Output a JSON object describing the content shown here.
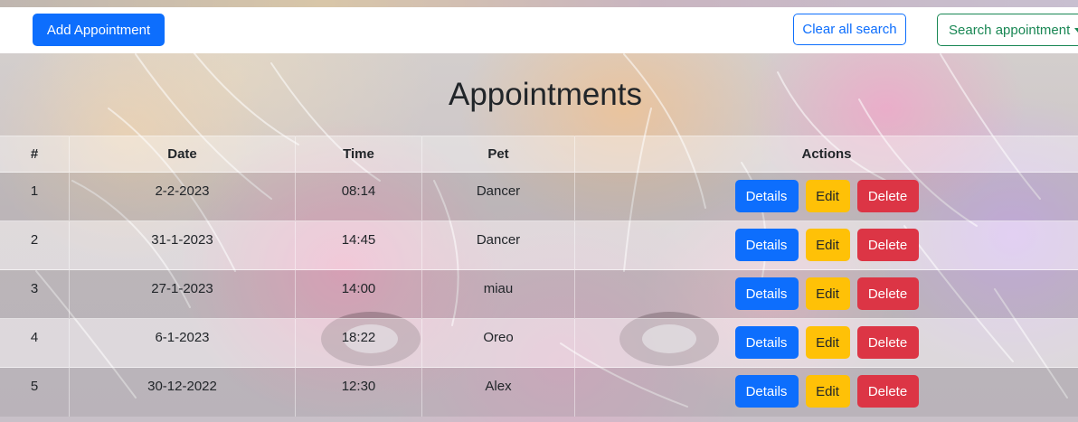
{
  "toolbar": {
    "add_label": "Add Appointment",
    "clear_label": "Clear all search",
    "search_label": "Search appointment"
  },
  "page": {
    "title": "Appointments"
  },
  "table": {
    "headers": [
      "#",
      "Date",
      "Time",
      "Pet",
      "Actions"
    ],
    "rows": [
      {
        "num": "1",
        "date": "2-2-2023",
        "time": "08:14",
        "pet": "Dancer"
      },
      {
        "num": "2",
        "date": "31-1-2023",
        "time": "14:45",
        "pet": "Dancer"
      },
      {
        "num": "3",
        "date": "27-1-2023",
        "time": "14:00",
        "pet": "miau"
      },
      {
        "num": "4",
        "date": "6-1-2023",
        "time": "18:22",
        "pet": "Oreo"
      },
      {
        "num": "5",
        "date": "30-12-2022",
        "time": "12:30",
        "pet": "Alex"
      }
    ],
    "actions": {
      "details": "Details",
      "edit": "Edit",
      "delete": "Delete"
    }
  },
  "colors": {
    "primary": "#0d6efd",
    "success": "#198754",
    "warning": "#ffc107",
    "danger": "#dc3545"
  }
}
